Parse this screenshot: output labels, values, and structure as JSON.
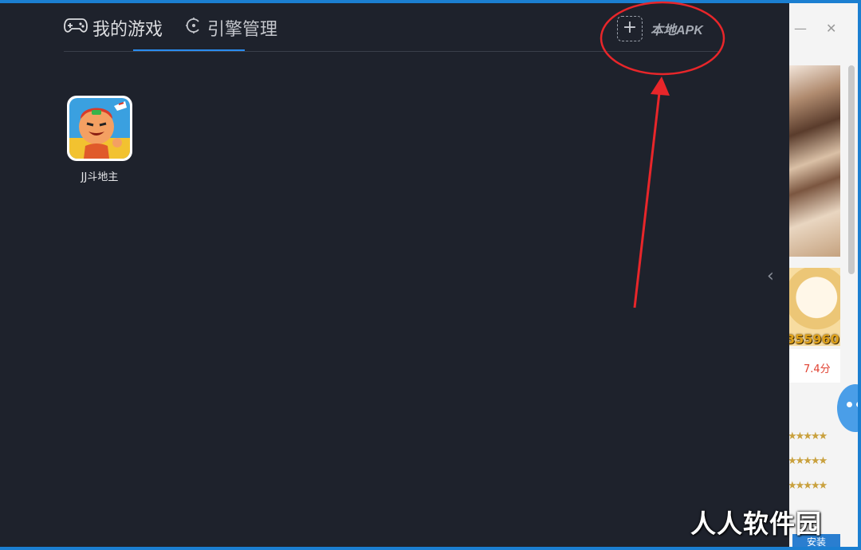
{
  "header": {
    "tabs": [
      {
        "label": "我的游戏",
        "icon": "gamepad-icon",
        "active": true
      },
      {
        "label": "引擎管理",
        "icon": "engine-icon",
        "active": false
      }
    ],
    "local_apk_label": "本地APK",
    "local_apk_icon": "add-icon"
  },
  "games": [
    {
      "name": "JJ斗地主",
      "icon": "game-app-icon"
    }
  ],
  "background_window": {
    "score_text": "355960",
    "rating_text": "7.4分",
    "install_label": "安装",
    "stars": [
      "★★★★★",
      "★★★★★",
      "★★★★★"
    ]
  },
  "watermark": "人人软件园",
  "colors": {
    "panel_bg": "#1e222c",
    "accent": "#2a8cf0",
    "annotation": "#e8262a",
    "desktop": "#1b7fd1"
  }
}
